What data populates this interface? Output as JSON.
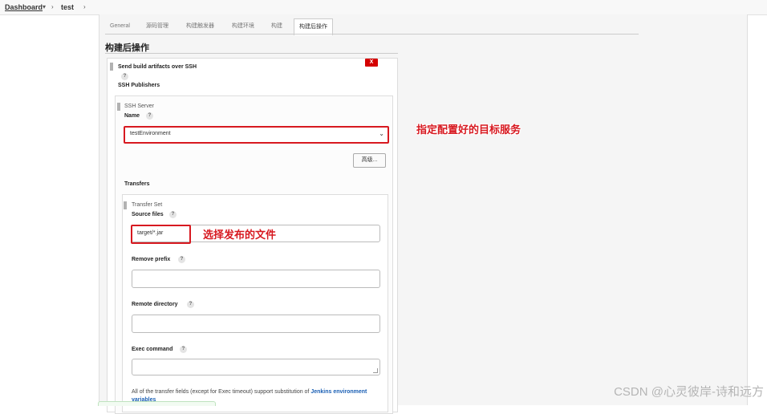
{
  "breadcrumb": {
    "root": "Dashboard",
    "root_dropdown": "▾",
    "sep": "›",
    "job": "test"
  },
  "tabs": [
    "General",
    "源码管理",
    "构建触发器",
    "构建环境",
    "构建",
    "构建后操作"
  ],
  "active_tab": "构建后操作",
  "section_title": "构建后操作",
  "step": {
    "title": "Send build artifacts over SSH",
    "delete_label": "X",
    "publishers_label": "SSH Publishers",
    "server": {
      "header": "SSH Server",
      "name_label": "Name",
      "name_value": "testEnvironment",
      "advanced_button": "高级..."
    },
    "transfers_label": "Transfers",
    "transfer_set": {
      "header": "Transfer Set",
      "source_files_label": "Source files",
      "source_files_value": "target/*.jar",
      "remove_prefix_label": "Remove prefix",
      "remote_directory_label": "Remote directory",
      "exec_command_label": "Exec command",
      "help_text_prefix": "All of the transfer fields (except for Exec timeout) support substitution of ",
      "help_link": "Jenkins environment variables"
    }
  },
  "help_icon": "?",
  "annotations": {
    "target_server": "指定配置好的目标服务",
    "select_files": "选择发布的文件"
  },
  "watermark": "CSDN @心灵彼岸-诗和远方",
  "colors": {
    "annotation_red": "#d71920",
    "delete_red": "#d40000",
    "link_blue": "#1a5fb4"
  }
}
